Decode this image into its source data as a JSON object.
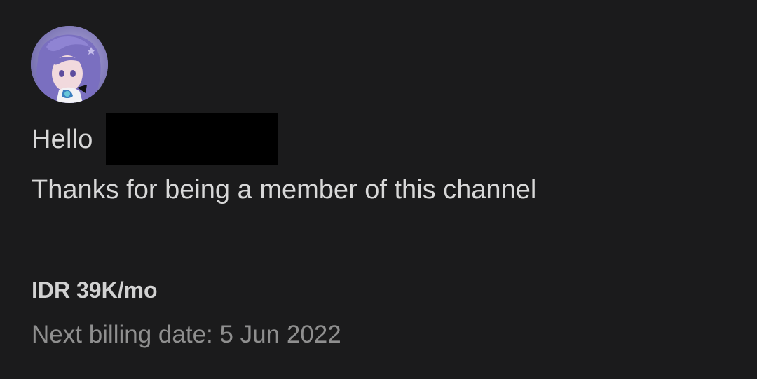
{
  "avatar": {
    "icon": "channel-avatar",
    "alt": "Channel avatar"
  },
  "greeting": {
    "text": "Hello"
  },
  "message": {
    "text": "Thanks for being a member of this channel"
  },
  "membership": {
    "price": "IDR 39K/mo",
    "next_billing": "Next billing date: 5 Jun 2022"
  },
  "colors": {
    "background": "#1b1b1c",
    "primary_text": "#d8d8d8",
    "secondary_text": "#8f8f8f",
    "redaction": "#000000"
  }
}
